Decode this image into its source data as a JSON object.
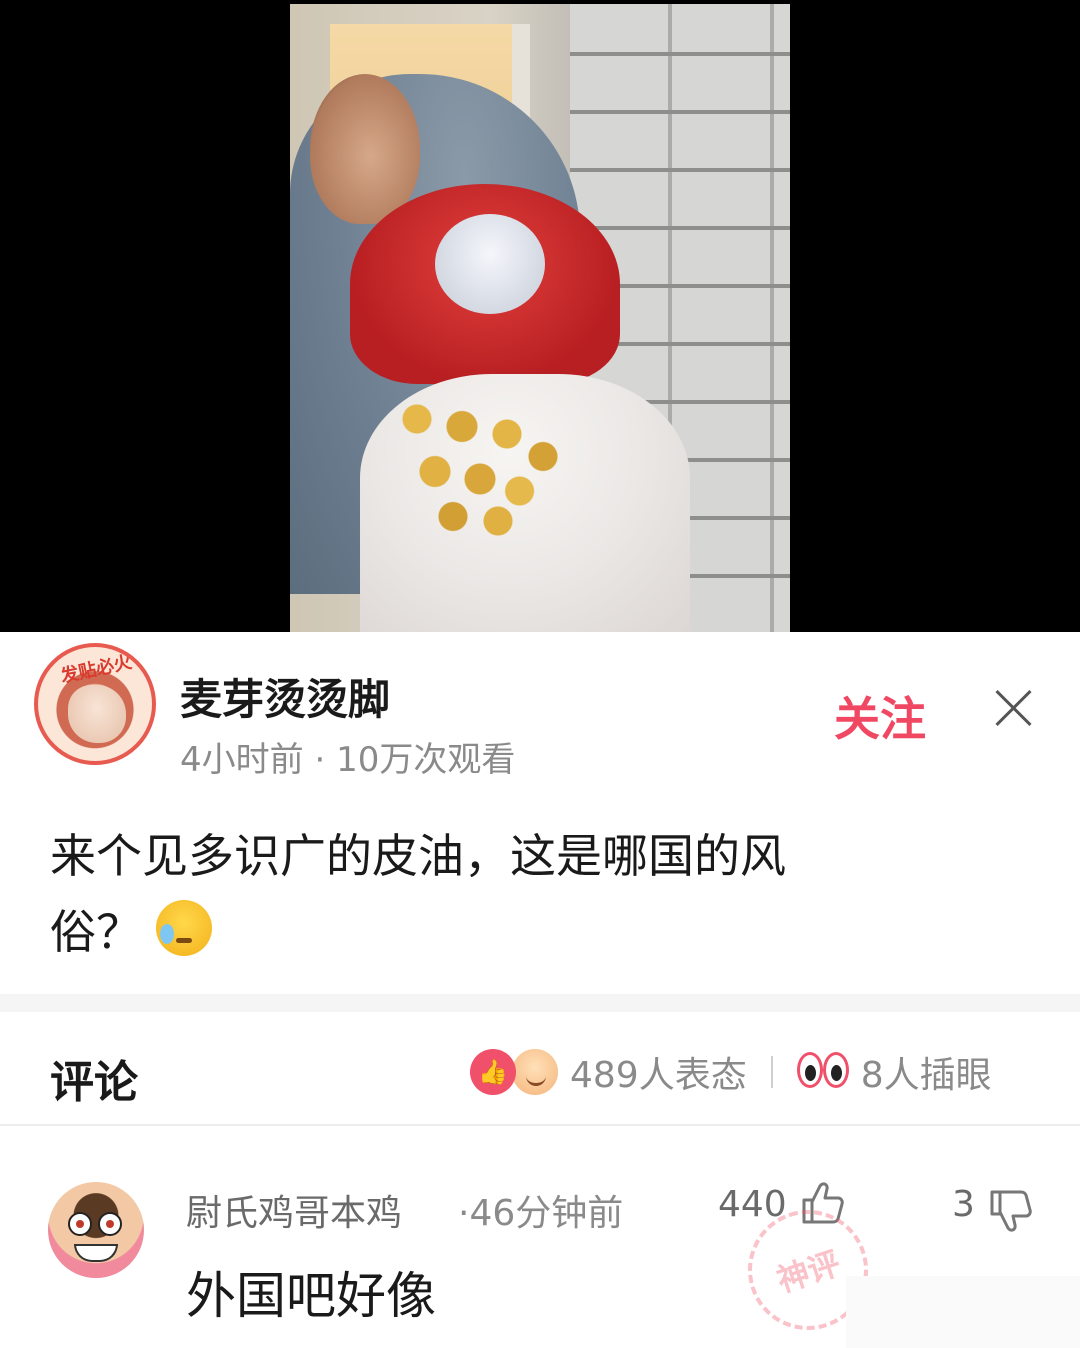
{
  "post": {
    "author": "麦芽烫烫脚",
    "avatar_stamp": "发贴必火",
    "time_ago": "4小时前",
    "views": "10万次观看",
    "follow_label": "关注",
    "text_line1": "来个见多识广的皮油，这是哪国的风",
    "text_line2": "俗？",
    "emoji": "sweat-face-icon"
  },
  "comments_header": {
    "title": "评论",
    "reactions": "489人表态",
    "interjections": "8人插眼"
  },
  "comments": [
    {
      "author": "尉氏鸡哥本鸡",
      "time_ago": "·46分钟前",
      "likes": "440",
      "dislikes": "3",
      "text": "外国吧好像",
      "badge": "神评"
    }
  ],
  "colors": {
    "accent": "#f04862",
    "muted_text": "#8a8a8a",
    "video_bg": "#000000"
  }
}
